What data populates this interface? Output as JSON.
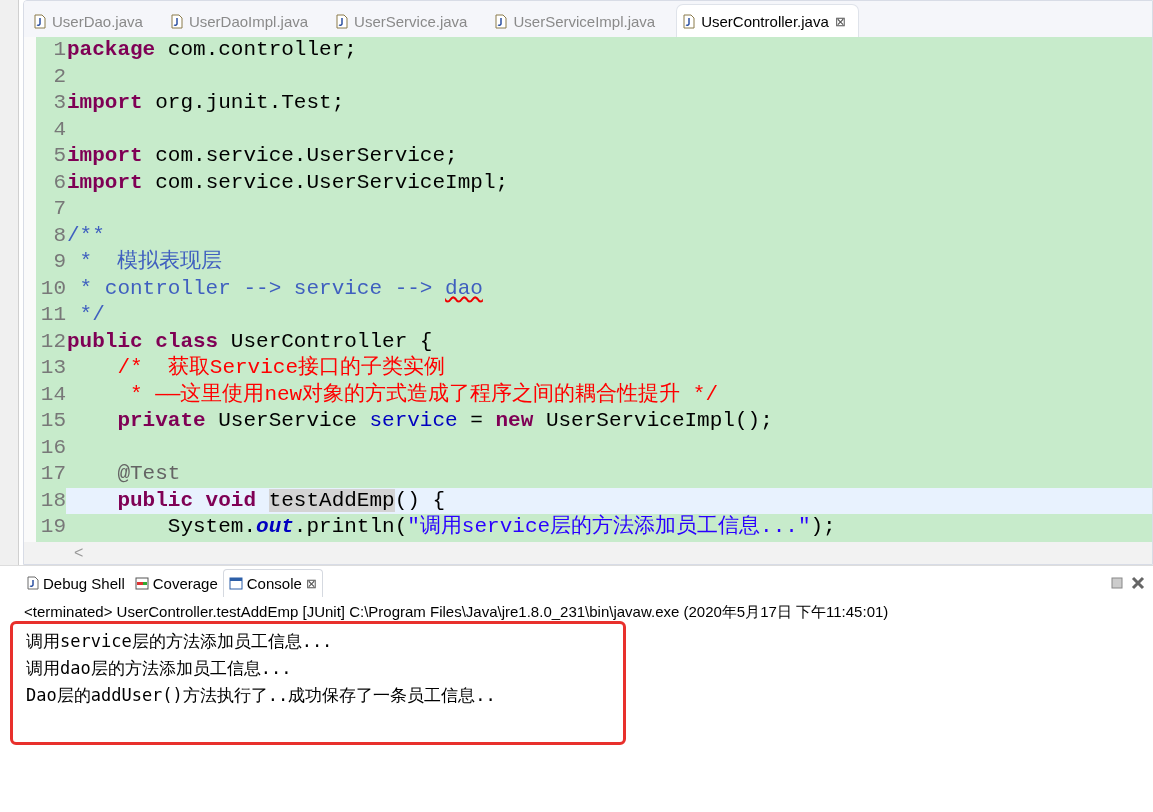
{
  "editor": {
    "tabs": [
      {
        "label": "UserDao.java",
        "selected": false
      },
      {
        "label": "UserDaoImpl.java",
        "selected": false
      },
      {
        "label": "UserService.java",
        "selected": false
      },
      {
        "label": "UserServiceImpl.java",
        "selected": false
      },
      {
        "label": "UserController.java",
        "selected": true,
        "close": "⊠"
      }
    ],
    "lines": [
      {
        "number": "1",
        "current": false,
        "segments": [
          {
            "kind": "kw",
            "text": "package"
          },
          {
            "kind": "plain",
            "text": " com.controller;"
          }
        ]
      },
      {
        "number": "2",
        "current": false
      },
      {
        "number": "3",
        "current": false,
        "segments": [
          {
            "kind": "kw",
            "text": "import"
          },
          {
            "kind": "plain",
            "text": " org.junit.Test;"
          }
        ]
      },
      {
        "number": "4",
        "current": false
      },
      {
        "number": "5",
        "current": false,
        "segments": [
          {
            "kind": "kw",
            "text": "import"
          },
          {
            "kind": "plain",
            "text": " com.service.UserService;"
          }
        ]
      },
      {
        "number": "6",
        "current": false,
        "segments": [
          {
            "kind": "kw",
            "text": "import"
          },
          {
            "kind": "plain",
            "text": " com.service.UserServiceImpl;"
          }
        ]
      },
      {
        "number": "7",
        "current": false
      },
      {
        "number": "8",
        "current": false,
        "segments": [
          {
            "kind": "doc",
            "text": "/**"
          }
        ]
      },
      {
        "number": "9",
        "current": false,
        "segments": [
          {
            "kind": "doc",
            "text": " *  模拟表现层"
          }
        ]
      },
      {
        "number": "10",
        "current": false,
        "segments": [
          {
            "kind": "doc",
            "text": " * controller --> service --> "
          },
          {
            "kind": "misspelled",
            "text": "dao"
          }
        ]
      },
      {
        "number": "11",
        "current": false,
        "segments": [
          {
            "kind": "doc",
            "text": " */"
          }
        ]
      },
      {
        "number": "12",
        "current": false,
        "segments": [
          {
            "kind": "kw",
            "text": "public class"
          },
          {
            "kind": "plain",
            "text": " UserController {"
          }
        ]
      },
      {
        "number": "13",
        "current": false,
        "segments": [
          {
            "kind": "red",
            "text": "    /*  获取Service接口的子类实例"
          }
        ]
      },
      {
        "number": "14",
        "current": false,
        "segments": [
          {
            "kind": "red",
            "text": "     * ——这里使用new对象的方式造成了程序之间的耦合性提升 */"
          }
        ]
      },
      {
        "number": "15",
        "current": false,
        "segments": [
          {
            "kind": "kw",
            "text": "    private"
          },
          {
            "kind": "plain",
            "text": " UserService "
          },
          {
            "kind": "field",
            "text": "service"
          },
          {
            "kind": "plain",
            "text": " = "
          },
          {
            "kind": "kw",
            "text": "new"
          },
          {
            "kind": "plain",
            "text": " UserServiceImpl();"
          }
        ]
      },
      {
        "number": "16",
        "current": false
      },
      {
        "number": "17",
        "current": false,
        "segments": [
          {
            "kind": "ann",
            "text": "    @Test"
          }
        ]
      },
      {
        "number": "18",
        "current": true,
        "segments": [
          {
            "kind": "kw",
            "text": "    public void "
          },
          {
            "kind": "method",
            "text": "testAddEmp"
          },
          {
            "kind": "plain",
            "text": "() {"
          }
        ]
      },
      {
        "number": "19",
        "current": false,
        "segments": [
          {
            "kind": "plain",
            "text": "        System."
          },
          {
            "kind": "static",
            "text": "out"
          },
          {
            "kind": "plain",
            "text": ".println("
          },
          {
            "kind": "str",
            "text": "\"调用service层的方法添加员工信息...\""
          },
          {
            "kind": "plain",
            "text": ");"
          }
        ]
      }
    ],
    "scroll_left": "<"
  },
  "console": {
    "tabs": [
      {
        "label": "Debug Shell",
        "kind": "shell",
        "selected": false
      },
      {
        "label": "Coverage",
        "kind": "coverage",
        "selected": false
      },
      {
        "label": "Console",
        "kind": "console",
        "selected": true,
        "close": "⊠"
      }
    ],
    "status": "<terminated> UserController.testAddEmp [JUnit] C:\\Program Files\\Java\\jre1.8.0_231\\bin\\javaw.exe (2020年5月17日 下午11:45:01)",
    "output": [
      "调用service层的方法添加员工信息...",
      "调用dao层的方法添加员工信息...",
      "Dao层的addUser()方法执行了..成功保存了一条员工信息.."
    ],
    "highlighted": true
  }
}
